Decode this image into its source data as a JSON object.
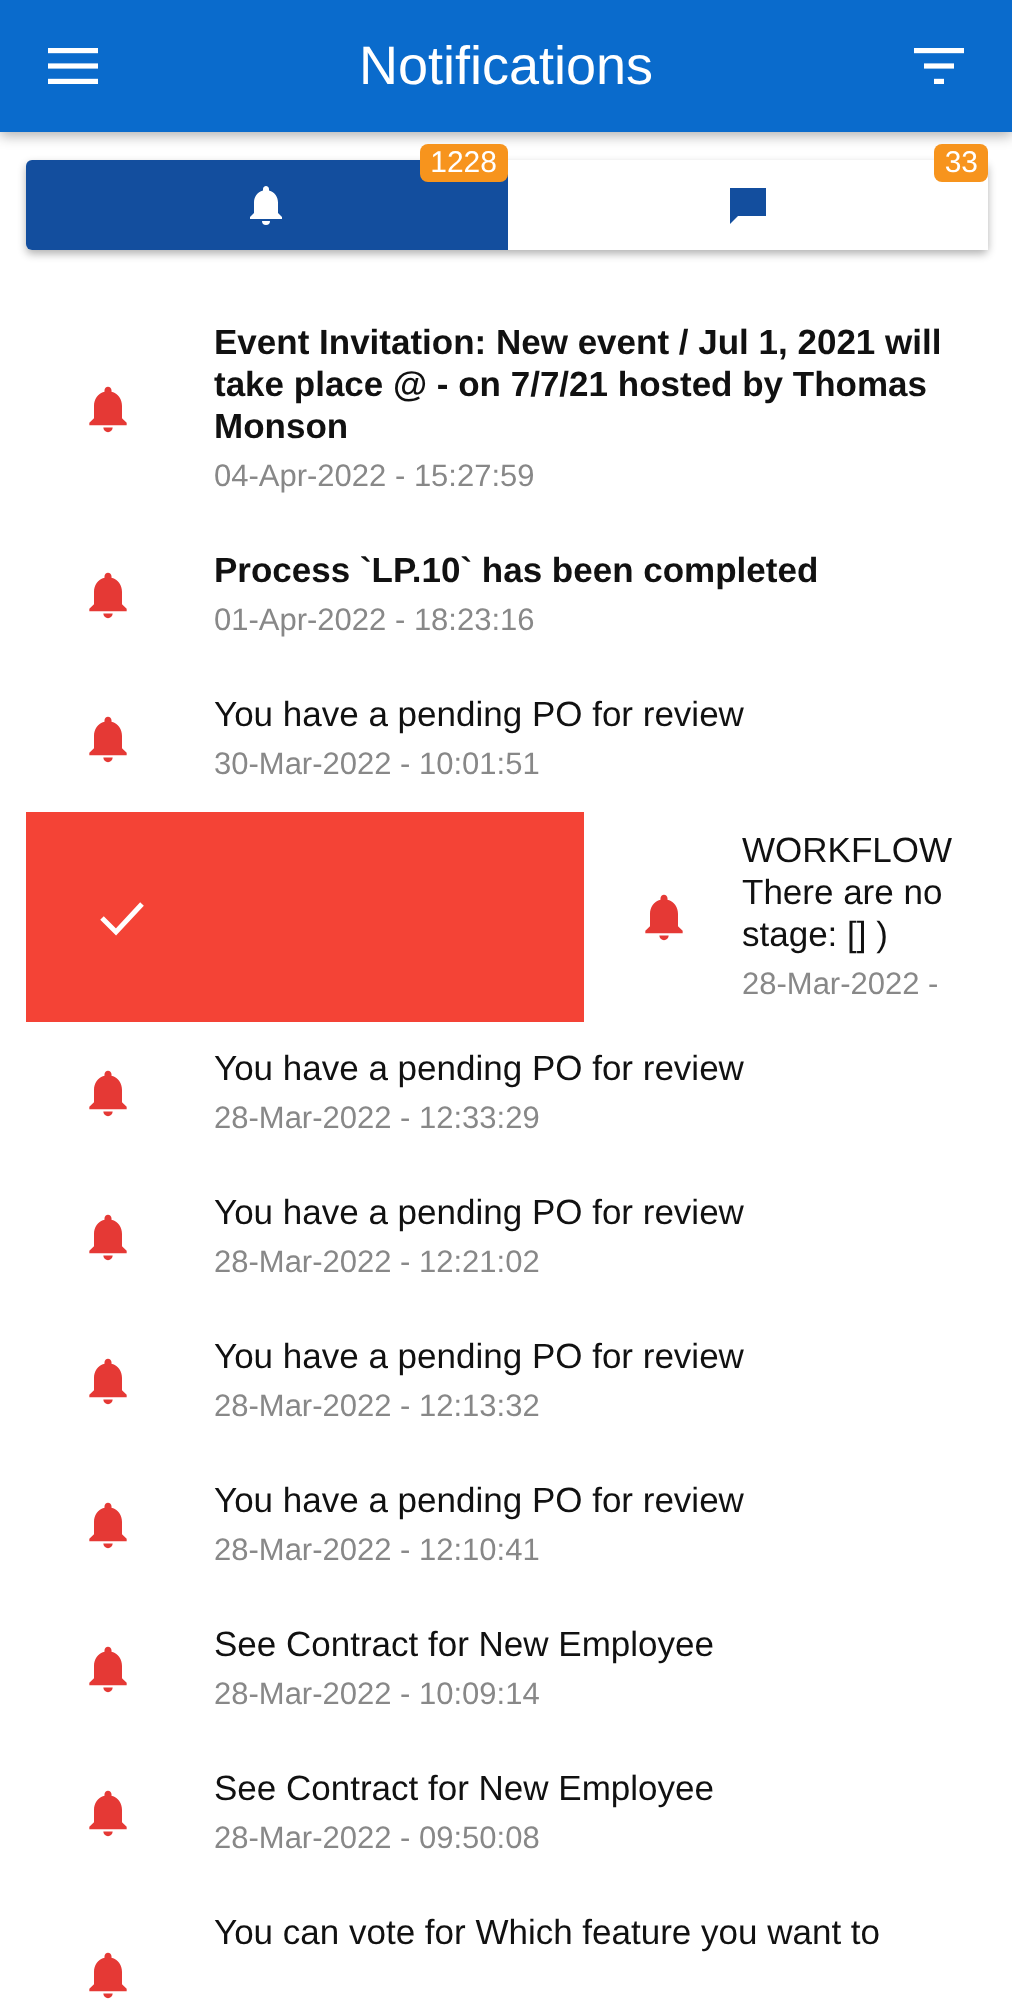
{
  "app_bar": {
    "title": "Notifications"
  },
  "tabs": [
    {
      "kind": "alerts",
      "badge": "1228",
      "selected": true
    },
    {
      "kind": "messages",
      "badge": "33",
      "selected": false
    }
  ],
  "notifications": [
    {
      "kind": "normal",
      "title": "Event Invitation: New event / Jul 1, 2021 will take place @ - on 7/7/21 hosted by Thomas Monson",
      "time": "04-Apr-2022 - 15:27:59",
      "unread": true
    },
    {
      "kind": "normal",
      "title": "Process `LP.10` has been completed",
      "time": "01-Apr-2022 - 18:23:16",
      "unread": true
    },
    {
      "kind": "normal",
      "title": "You have a pending PO for review",
      "time": "30-Mar-2022 - 10:01:51",
      "unread": false
    },
    {
      "kind": "swiped",
      "title_lines": [
        "WORKFLOW",
        "There are no",
        "stage: [] )"
      ],
      "time": "28-Mar-2022 -",
      "unread": false
    },
    {
      "kind": "normal",
      "title": "You have a pending PO for review",
      "time": "28-Mar-2022 - 12:33:29",
      "unread": false
    },
    {
      "kind": "normal",
      "title": "You have a pending PO for review",
      "time": "28-Mar-2022 - 12:21:02",
      "unread": false
    },
    {
      "kind": "normal",
      "title": "You have a pending PO for review",
      "time": "28-Mar-2022 - 12:13:32",
      "unread": false
    },
    {
      "kind": "normal",
      "title": "You have a pending PO for review",
      "time": "28-Mar-2022 - 12:10:41",
      "unread": false
    },
    {
      "kind": "normal",
      "title": "See Contract for New Employee",
      "time": "28-Mar-2022 - 10:09:14",
      "unread": false
    },
    {
      "kind": "normal",
      "title": "See Contract for New Employee",
      "time": "28-Mar-2022 - 09:50:08",
      "unread": false
    },
    {
      "kind": "cut",
      "title": "You can vote for Which feature you want to",
      "unread": false
    }
  ]
}
